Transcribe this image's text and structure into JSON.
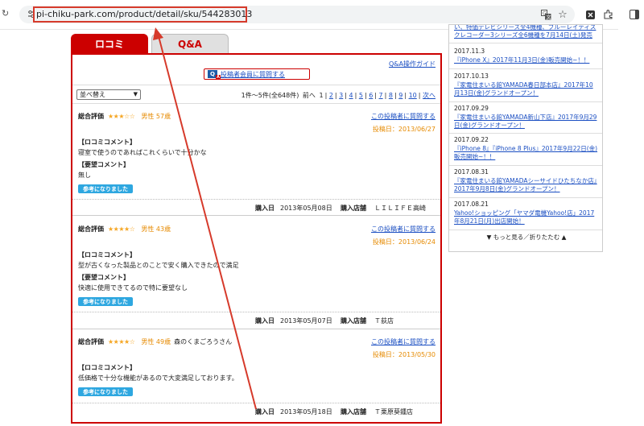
{
  "browser": {
    "url": "pi-chiku-park.com/product/detail/sku/544283013",
    "icons": [
      "reload-icon",
      "tune-icon",
      "translate-icon",
      "star-icon",
      "extension-icon",
      "puzzle-icon",
      "sidepanel-icon"
    ]
  },
  "tabs": {
    "review": "ロコミ",
    "qa": "Q&A"
  },
  "reviews_section": {
    "qa_guide_link": "Q&A操作ガイド",
    "ask_member_button": "投稿者会員に質問する",
    "sort_value": "並べ替え",
    "result_count": "1件～5件(全648件)",
    "pager_prev": "前へ",
    "pages": [
      "1",
      "2",
      "3",
      "4",
      "5",
      "6",
      "7",
      "8",
      "9",
      "10"
    ],
    "pager_next": "次へ",
    "items": [
      {
        "rating_label": "総合評価",
        "stars": "★★★☆☆",
        "rating": 3,
        "gender_age": "男性 57歳",
        "nickname": "",
        "ask_link": "この投稿者に質問する",
        "post_date": "投稿日：2013/06/27",
        "comment_title": "【ロコミコメント】",
        "comment": "寝室で使うのであればこれくらいで十分かな",
        "request_title": "【要望コメント】",
        "request": "無し",
        "helpful": "参考になりました",
        "purchase_date_label": "購入日",
        "purchase_date": "2013年05月08日",
        "store_label": "購入店舗",
        "store": "ＬＩＬＩＦＥ高崎"
      },
      {
        "rating_label": "総合評価",
        "stars": "★★★★☆",
        "rating": 4,
        "gender_age": "男性 43歳",
        "nickname": "",
        "ask_link": "この投稿者に質問する",
        "post_date": "投稿日：2013/06/24",
        "comment_title": "【ロコミコメント】",
        "comment": "型が古くなった製品とのことで安く購入できたので満足",
        "request_title": "【要望コメント】",
        "request": "快適に使用できてるので特に要望なし",
        "helpful": "参考になりました",
        "purchase_date_label": "購入日",
        "purchase_date": "2013年05月07日",
        "store_label": "購入店舗",
        "store": "Ｔ荻店"
      },
      {
        "rating_label": "総合評価",
        "stars": "★★★★☆",
        "rating": 4,
        "gender_age": "男性 49歳",
        "nickname": "森のくまごろうさん",
        "ask_link": "この投稿者に質問する",
        "post_date": "投稿日：2013/05/30",
        "comment_title": "【ロコミコメント】",
        "comment": "低価格で十分な機能があるので大変満足しております。",
        "request_title": "",
        "request": "",
        "helpful": "参考になりました",
        "purchase_date_label": "購入日",
        "purchase_date": "2013年05月18日",
        "store_label": "購入店舗",
        "store": "Ｔ栗原葵鍾店"
      }
    ]
  },
  "news": {
    "items": [
      {
        "date": "",
        "text": "い、特価テレビシリーズ全4機種、ブルーレイディスクレコーダー3シリーズ全6機種を7月14日(土)発売"
      },
      {
        "date": "2017.11.3",
        "text": "『iPhone X』2017年11月3日(金)販売開始~！！"
      },
      {
        "date": "2017.10.13",
        "text": "『家電住まいる館YAMADA春日部本店』2017年10月13日(金)グランドオープン！"
      },
      {
        "date": "2017.09.29",
        "text": "『家電住まいる館YAMADA新山下店』2017年9月29日(金)グランドオープン！"
      },
      {
        "date": "2017.09.22",
        "text": "『iPhone 8』『iPhone 8 Plus』2017年9月22日(金)販売開始~！！"
      },
      {
        "date": "2017.08.31",
        "text": "『家電住まいる館YAMADAシーサイドひたちなか店』2017年9月8日(金)グランドオープン！"
      },
      {
        "date": "2017.08.21",
        "text": "Yahoo!ショッピング「ヤマダ電機Yahoo!店」2017年8月21日(月)出店開始！"
      }
    ],
    "more": "▼ もっと見る／折りたたむ ▲"
  },
  "colors": {
    "accent": "#cc0000",
    "link": "#1a4ec2",
    "star": "#f5a623",
    "helpful_button": "#2ea7e0",
    "annotation": "#d63a2b"
  }
}
